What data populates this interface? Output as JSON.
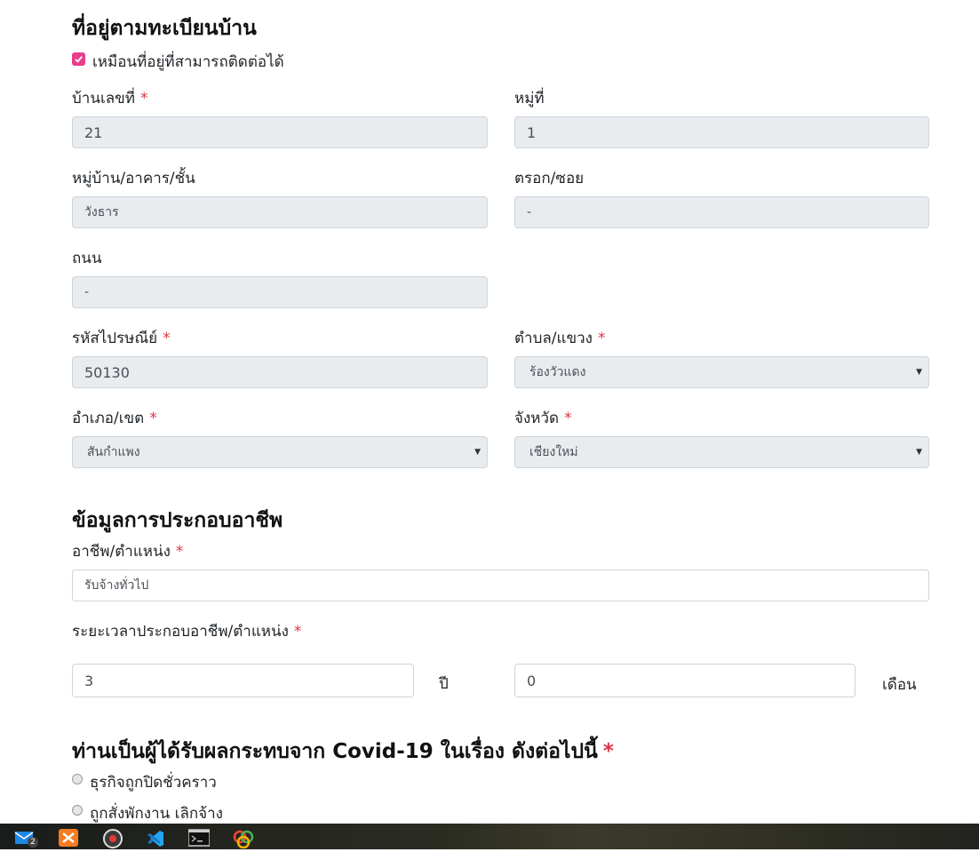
{
  "registered_address": {
    "title": "ที่อยู่ตามทะเบียนบ้าน",
    "same_as_contact_label": "เหมือนที่อยู่ที่สามารถติดต่อได้",
    "house_no": {
      "label": "บ้านเลขที่",
      "value": "21"
    },
    "moo": {
      "label": "หมู่ที่",
      "value": "1"
    },
    "village": {
      "label": "หมู่บ้าน/อาคาร/ชั้น",
      "value": "วังธาร"
    },
    "soi": {
      "label": "ตรอก/ซอย",
      "value": "-"
    },
    "road": {
      "label": "ถนน",
      "value": "-"
    },
    "postcode": {
      "label": "รหัสไปรษณีย์",
      "value": "50130"
    },
    "subdistrict": {
      "label": "ตำบล/แขวง",
      "value": "ร้องวัวแดง"
    },
    "district": {
      "label": "อำเภอ/เขต",
      "value": "สันกำแพง"
    },
    "province": {
      "label": "จังหวัด",
      "value": "เชียงใหม่"
    }
  },
  "occupation": {
    "title": "ข้อมูลการประกอบอาชีพ",
    "position": {
      "label": "อาชีพ/ตำแหน่ง",
      "value": "รับจ้างทั่วไป"
    },
    "duration": {
      "label": "ระยะเวลาประกอบอาชีพ/ตำแหน่ง",
      "years_value": "3",
      "years_unit": "ปี",
      "months_value": "0",
      "months_unit": "เดือน"
    }
  },
  "covid": {
    "title": "ท่านเป็นผู้ได้รับผลกระทบจาก Covid-19 ในเรื่อง ดังต่อไปนี้",
    "options": [
      "ธุรกิจถูกปิดชั่วคราว",
      "ถูกสั่งพักงาน เลิกจ้าง"
    ]
  },
  "required_mark": "*",
  "colors": {
    "accent": "#e83e8c",
    "required": "#dc3545",
    "readonly_bg": "#e9ecef"
  },
  "taskbar": {
    "icons": [
      "mail-icon",
      "xampp-icon",
      "media-player-icon",
      "vscode-icon",
      "terminal-icon",
      "app-icon"
    ],
    "mail_badge": "2"
  }
}
